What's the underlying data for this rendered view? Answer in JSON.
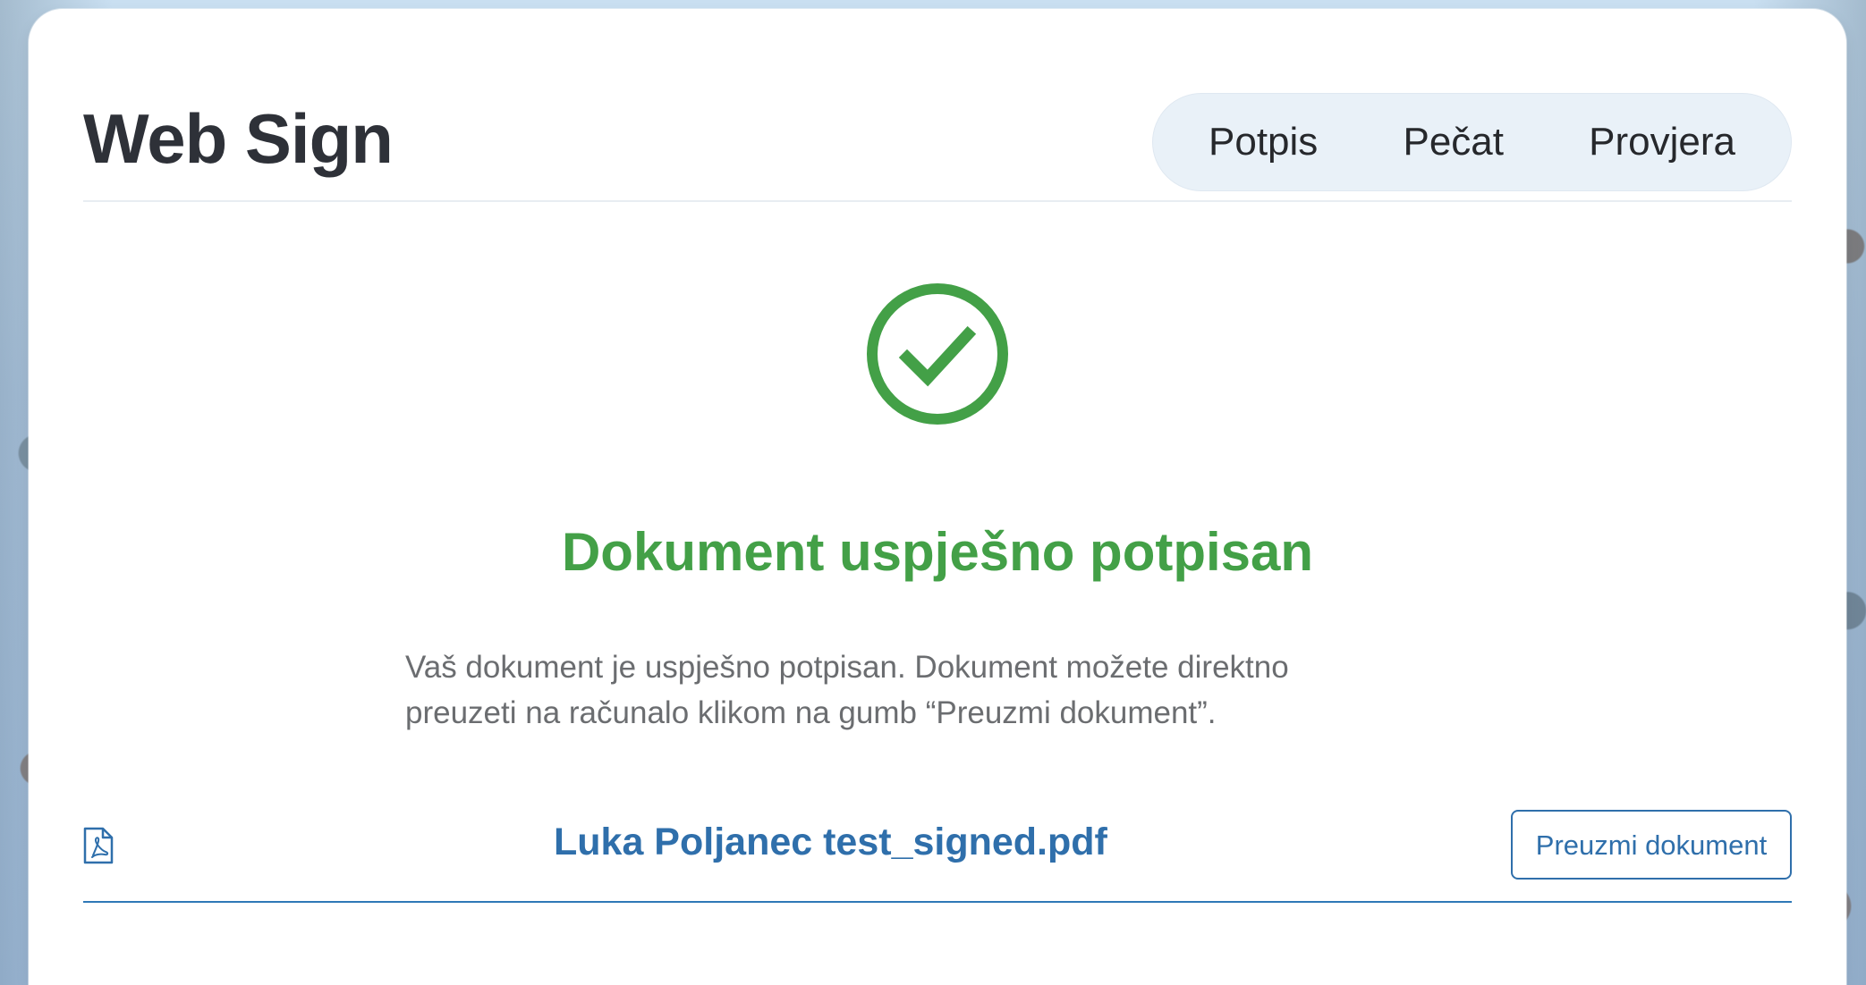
{
  "app": {
    "title": "Web Sign"
  },
  "nav": {
    "items": [
      {
        "label": "Potpis"
      },
      {
        "label": "Pečat"
      },
      {
        "label": "Provjera"
      }
    ]
  },
  "status": {
    "icon": "check-circle-icon",
    "title": "Dokument uspješno potpisan",
    "description": "Vaš dokument je uspješno potpisan. Dokument možete direktno preuzeti na računalo klikom na gumb “Preuzmi dokument”."
  },
  "file": {
    "icon": "pdf-file-icon",
    "name": "Luka Poljanec test_signed.pdf",
    "download_label": "Preuzmi dokument"
  },
  "colors": {
    "success": "#43a047",
    "link": "#2f6fab",
    "title_text": "#2e3138",
    "body_text": "#6b6d70",
    "nav_bg": "#e9f1f8"
  }
}
